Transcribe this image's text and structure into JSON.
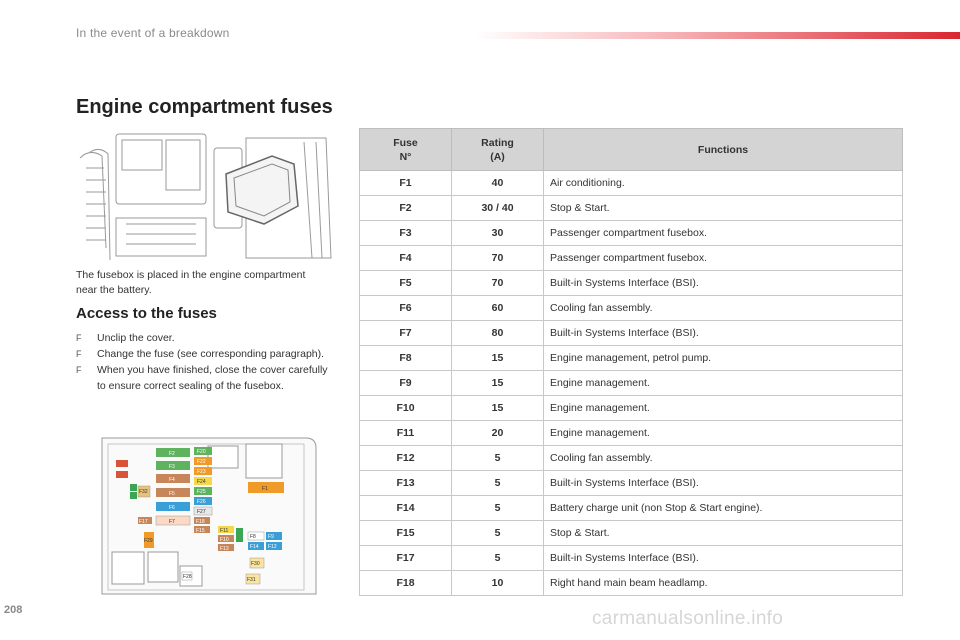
{
  "header": {
    "section": "In the event of a breakdown"
  },
  "page_title": "Engine compartment fuses",
  "intro": "The fusebox is placed in the engine compartment near the battery.",
  "access": {
    "title": "Access to the fuses",
    "bullet_glyph": "F",
    "steps": [
      "Unclip the cover.",
      "Change the fuse (see corresponding paragraph).",
      "When you have finished, close the cover carefully to ensure correct sealing of the fusebox."
    ]
  },
  "table": {
    "headers": {
      "fuse_line1": "Fuse",
      "fuse_line2": "N°",
      "rating_line1": "Rating",
      "rating_line2": "(A)",
      "functions": "Functions"
    },
    "rows": [
      {
        "fuse": "F1",
        "rating": "40",
        "function": "Air conditioning."
      },
      {
        "fuse": "F2",
        "rating": "30 / 40",
        "function": "Stop & Start."
      },
      {
        "fuse": "F3",
        "rating": "30",
        "function": "Passenger compartment fusebox."
      },
      {
        "fuse": "F4",
        "rating": "70",
        "function": "Passenger compartment fusebox."
      },
      {
        "fuse": "F5",
        "rating": "70",
        "function": "Built-in Systems Interface (BSI)."
      },
      {
        "fuse": "F6",
        "rating": "60",
        "function": "Cooling fan assembly."
      },
      {
        "fuse": "F7",
        "rating": "80",
        "function": "Built-in Systems Interface (BSI)."
      },
      {
        "fuse": "F8",
        "rating": "15",
        "function": "Engine management, petrol pump."
      },
      {
        "fuse": "F9",
        "rating": "15",
        "function": "Engine management."
      },
      {
        "fuse": "F10",
        "rating": "15",
        "function": "Engine management."
      },
      {
        "fuse": "F11",
        "rating": "20",
        "function": "Engine management."
      },
      {
        "fuse": "F12",
        "rating": "5",
        "function": "Cooling fan assembly."
      },
      {
        "fuse": "F13",
        "rating": "5",
        "function": "Built-in Systems Interface (BSI)."
      },
      {
        "fuse": "F14",
        "rating": "5",
        "function": "Battery charge unit (non Stop & Start engine)."
      },
      {
        "fuse": "F15",
        "rating": "5",
        "function": "Stop & Start."
      },
      {
        "fuse": "F17",
        "rating": "5",
        "function": "Built-in Systems Interface (BSI)."
      },
      {
        "fuse": "F18",
        "rating": "10",
        "function": "Right hand main beam headlamp."
      }
    ]
  },
  "fusebox_labels": [
    "F2",
    "F3",
    "F4",
    "F5",
    "F6",
    "F7",
    "F8",
    "F9",
    "F10",
    "F11",
    "F12",
    "F13",
    "F14",
    "F15",
    "F17",
    "F18",
    "F20",
    "F22",
    "F23",
    "F24",
    "F25",
    "F26",
    "F27",
    "F28",
    "F29",
    "F30",
    "F31",
    "F32",
    "F1"
  ],
  "page_number": "208",
  "watermark": "carmanualsonline.info",
  "colors": {
    "accent": "#d9262f",
    "table_header": "#d4d4d4"
  }
}
